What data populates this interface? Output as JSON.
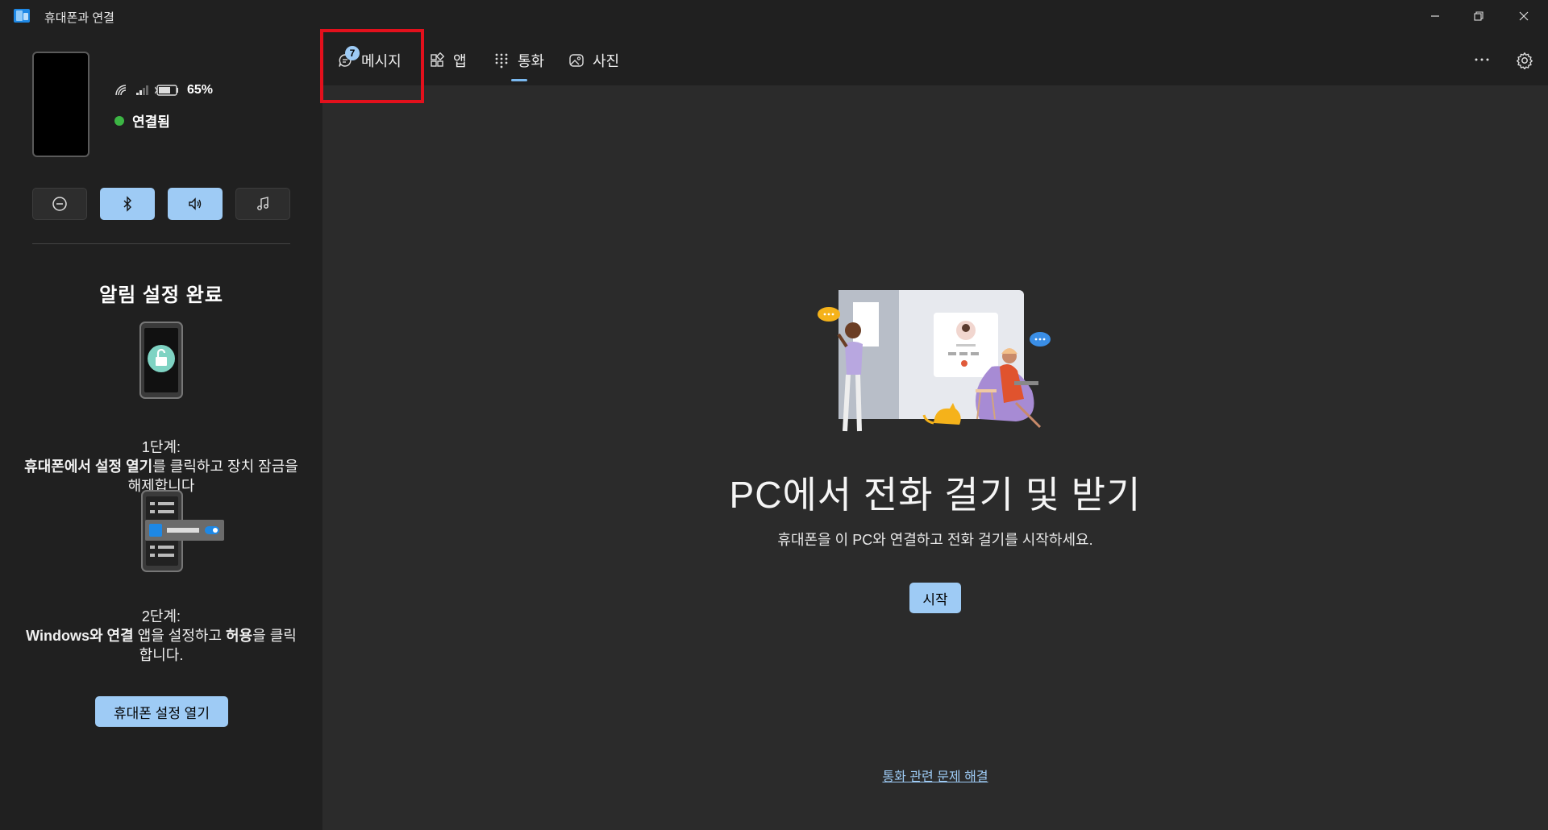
{
  "window": {
    "title": "휴대폰과 연결",
    "icon": "phone-link-app-icon"
  },
  "device": {
    "battery": "65%",
    "connection_status": "연결됨",
    "status_color": "#3cb544"
  },
  "quick_actions": [
    {
      "name": "do-not-disturb",
      "icon": "minus-circle-icon",
      "active": false
    },
    {
      "name": "bluetooth",
      "icon": "bluetooth-icon",
      "active": true
    },
    {
      "name": "audio",
      "icon": "speaker-icon",
      "active": true
    },
    {
      "name": "music",
      "icon": "music-note-icon",
      "active": false
    }
  ],
  "notifications": {
    "title": "알림 설정 완료",
    "step1_label": "1단계:",
    "step1_bold": "휴대폰에서 설정 열기",
    "step1_rest": "를 클릭하고 장치 잠금을 해제합니다",
    "step2_label": "2단계:",
    "step2_bold1": "Windows와 연결",
    "step2_mid": " 앱을 설정하고 ",
    "step2_bold2": "허용",
    "step2_rest": "을 클릭합니다.",
    "open_button": "휴대폰 설정 열기"
  },
  "tabs": [
    {
      "label": "메시지",
      "icon": "message-icon",
      "badge": "7"
    },
    {
      "label": "앱",
      "icon": "apps-icon"
    },
    {
      "label": "통화",
      "icon": "dialpad-icon",
      "selected": true
    },
    {
      "label": "사진",
      "icon": "photo-icon"
    }
  ],
  "main": {
    "title": "PC에서 전화 걸기 및 받기",
    "subtitle": "휴대폰을 이 PC와 연결하고 전화 걸기를 시작하세요.",
    "start_button": "시작",
    "troubleshoot_link": "통화 관련 문제 해결"
  },
  "colors": {
    "accent": "#9ecbf5",
    "highlight": "#e3101c",
    "sidebar_bg": "#202020",
    "main_bg": "#2b2b2b"
  }
}
